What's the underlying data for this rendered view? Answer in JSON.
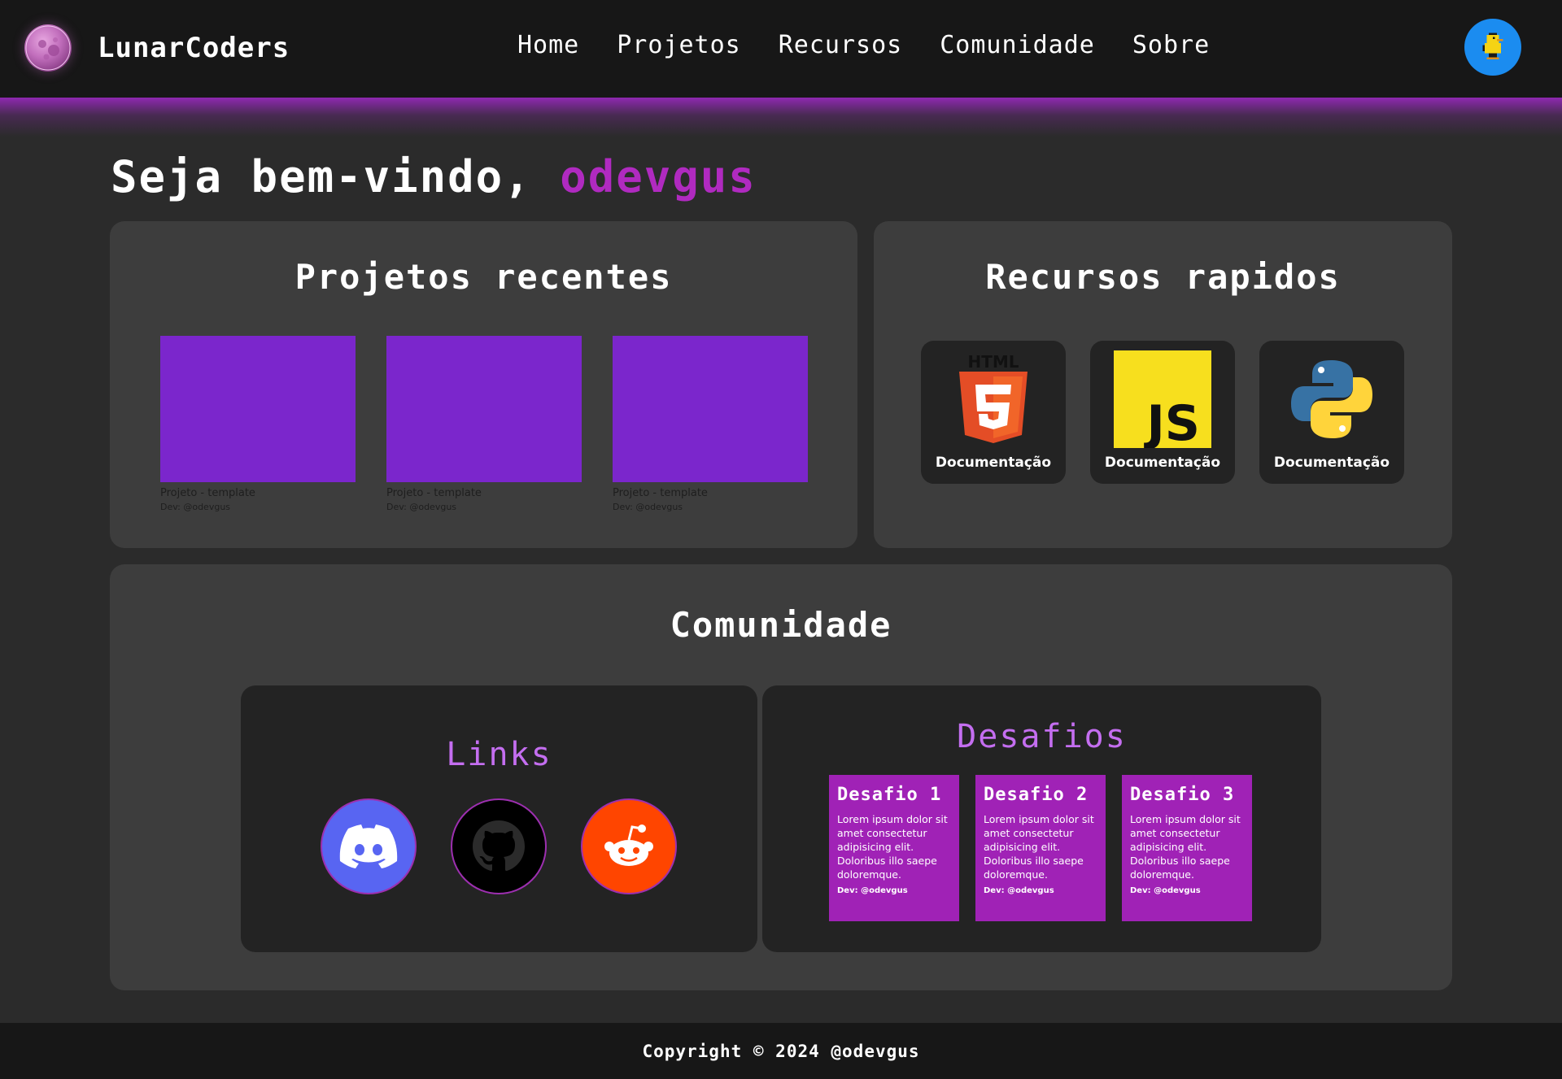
{
  "header": {
    "brand": "LunarCoders",
    "nav": [
      "Home",
      "Projetos",
      "Recursos",
      "Comunidade",
      "Sobre"
    ]
  },
  "welcome": {
    "greeting": "Seja bem-vindo,",
    "username": "odevgus"
  },
  "recent_projects": {
    "title": "Projetos recentes",
    "items": [
      {
        "name": "Projeto - template",
        "dev": "Dev: @odevgus"
      },
      {
        "name": "Projeto - template",
        "dev": "Dev: @odevgus"
      },
      {
        "name": "Projeto - template",
        "dev": "Dev: @odevgus"
      }
    ]
  },
  "quick_resources": {
    "title": "Recursos rapidos",
    "items": [
      {
        "icon": "html5-icon",
        "label": "Documentação",
        "badge": "HTML"
      },
      {
        "icon": "javascript-icon",
        "label": "Documentação",
        "badge": "JS"
      },
      {
        "icon": "python-icon",
        "label": "Documentação"
      }
    ]
  },
  "community": {
    "title": "Comunidade",
    "links": {
      "title": "Links",
      "items": [
        {
          "icon": "discord-icon",
          "color": "#5865f2"
        },
        {
          "icon": "github-icon",
          "color": "#000000"
        },
        {
          "icon": "reddit-icon",
          "color": "#ff4500"
        }
      ]
    },
    "challenges": {
      "title": "Desafios",
      "items": [
        {
          "title": "Desafio 1",
          "text": "Lorem ipsum dolor sit amet consectetur adipisicing elit. Doloribus illo saepe doloremque.",
          "dev": "Dev: @odevgus"
        },
        {
          "title": "Desafio 2",
          "text": "Lorem ipsum dolor sit amet consectetur adipisicing elit. Doloribus illo saepe doloremque.",
          "dev": "Dev: @odevgus"
        },
        {
          "title": "Desafio 3",
          "text": "Lorem ipsum dolor sit amet consectetur adipisicing elit. Doloribus illo saepe doloremque.",
          "dev": "Dev: @odevgus"
        }
      ]
    }
  },
  "footer": {
    "copyright": "Copyright © 2024 @odevgus"
  },
  "colors": {
    "accent": "#b02ac0",
    "project_thumb": "#7b26cc",
    "challenge_card": "#a022b6",
    "links_title": "#c46ef0"
  }
}
